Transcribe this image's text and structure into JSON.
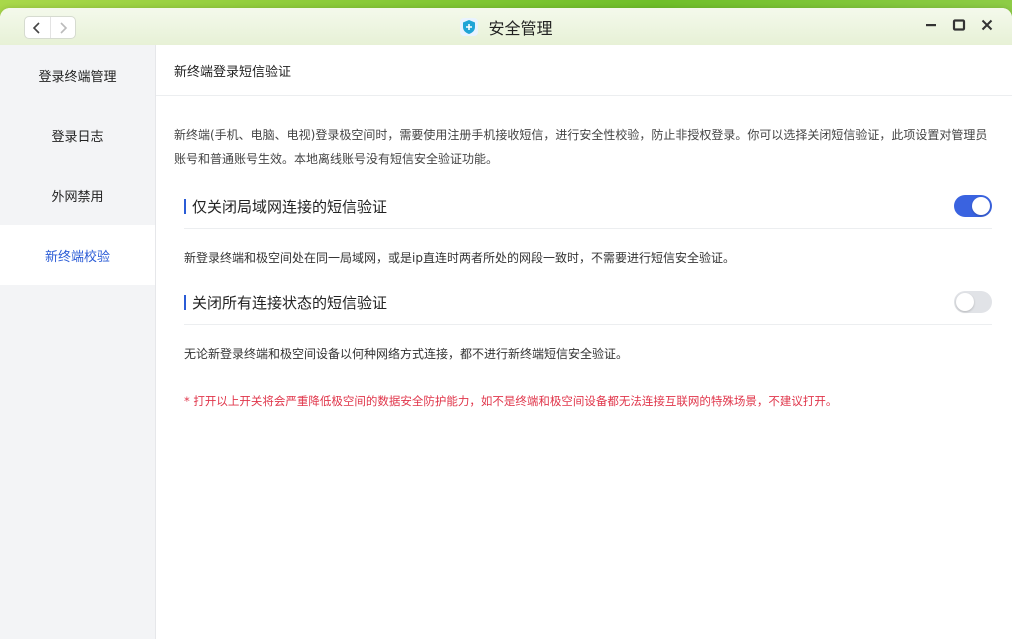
{
  "window": {
    "title": "安全管理",
    "icon": "shield-icon",
    "accent": "#2b5cd6",
    "toggle_on_color": "#3a63e0",
    "warning_color": "#e0354a"
  },
  "titlebar": {
    "back_icon": "chevron-left-icon",
    "forward_icon": "chevron-right-icon",
    "minimize_icon": "minimize-icon",
    "maximize_icon": "maximize-icon",
    "close_icon": "close-icon"
  },
  "sidebar": {
    "items": [
      {
        "label": "登录终端管理",
        "active": false
      },
      {
        "label": "登录日志",
        "active": false
      },
      {
        "label": "外网禁用",
        "active": false
      },
      {
        "label": "新终端校验",
        "active": true
      }
    ]
  },
  "main": {
    "header": "新终端登录短信验证",
    "description": "新终端(手机、电脑、电视)登录极空间时，需要使用注册手机接收短信，进行安全性校验，防止非授权登录。你可以选择关闭短信验证，此项设置对管理员账号和普通账号生效。本地离线账号没有短信安全验证功能。",
    "settings": [
      {
        "title": "仅关闭局域网连接的短信验证",
        "enabled": true,
        "description": "新登录终端和极空间处在同一局域网，或是ip直连时两者所处的网段一致时，不需要进行短信安全验证。"
      },
      {
        "title": "关闭所有连接状态的短信验证",
        "enabled": false,
        "description": "无论新登录终端和极空间设备以何种网络方式连接，都不进行新终端短信安全验证。"
      }
    ],
    "warning": "* 打开以上开关将会严重降低极空间的数据安全防护能力，如不是终端和极空间设备都无法连接互联网的特殊场景，不建议打开。"
  }
}
